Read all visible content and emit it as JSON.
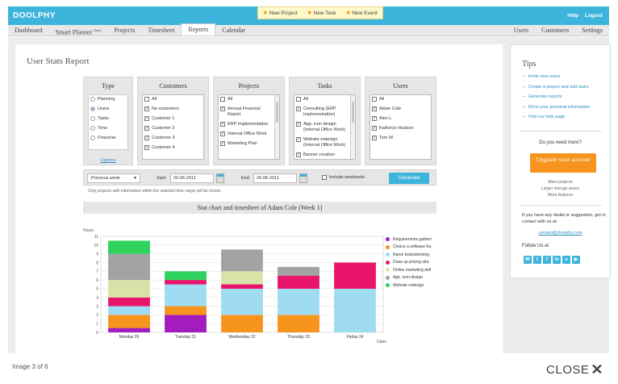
{
  "topbar": {
    "logo": "DOOLPHY",
    "quick_actions": [
      "New Project",
      "New Task",
      "New Event"
    ],
    "links": [
      "Help",
      "Logout"
    ]
  },
  "nav": {
    "left_tabs": [
      "Dashboard",
      "Smart Planner",
      "Projects",
      "Timesheet",
      "Reports",
      "Calendar"
    ],
    "beta_label": "(beta)",
    "active_tab": "Reports",
    "right_tabs": [
      "Users",
      "Customers",
      "Settings"
    ]
  },
  "report": {
    "title": "User Stats Report",
    "filters": {
      "type": {
        "heading": "Type",
        "options": [
          {
            "label": "Planning",
            "selected": false
          },
          {
            "label": "Users",
            "selected": true
          },
          {
            "label": "Tasks",
            "selected": false
          },
          {
            "label": "Time",
            "selected": false
          },
          {
            "label": "Financial",
            "selected": false
          }
        ],
        "options_link": "Options"
      },
      "customers": {
        "heading": "Customers",
        "items": [
          {
            "label": "All",
            "checked": false
          },
          {
            "label": "No customers",
            "checked": true
          },
          {
            "label": "Customer 1",
            "checked": true
          },
          {
            "label": "Customer 2",
            "checked": true
          },
          {
            "label": "Customer 3",
            "checked": true
          },
          {
            "label": "Customer 4",
            "checked": true
          }
        ]
      },
      "projects": {
        "heading": "Projects",
        "items": [
          {
            "label": "All",
            "checked": false
          },
          {
            "label": "Annual Financial Report",
            "checked": true
          },
          {
            "label": "ERP Implementation",
            "checked": true
          },
          {
            "label": "Internal Office Work",
            "checked": true
          },
          {
            "label": "Marketing Plan",
            "checked": true
          }
        ]
      },
      "tasks": {
        "heading": "Tasks",
        "items": [
          {
            "label": "All",
            "checked": false
          },
          {
            "label": "Consulting (ERP Implementation)",
            "checked": true
          },
          {
            "label": "App. icon design (Internal Office Work)",
            "checked": true
          },
          {
            "label": "Website redesign (Internal Office Work)",
            "checked": true
          },
          {
            "label": "Banner creation",
            "checked": true
          }
        ]
      },
      "users": {
        "heading": "Users",
        "items": [
          {
            "label": "All",
            "checked": false
          },
          {
            "label": "Adam Cole",
            "checked": true
          },
          {
            "label": "Alex L.",
            "checked": true
          },
          {
            "label": "Katheryn Hudson",
            "checked": true
          },
          {
            "label": "Tom W.",
            "checked": true
          }
        ]
      }
    },
    "period": {
      "selected": "Previous week",
      "start_label": "Start",
      "start_value": "20-06-2011",
      "end_label": "End",
      "end_value": "26-06-2011",
      "include_weekends_label": "Include weekends",
      "include_weekends": false,
      "generate_label": "Generate"
    },
    "note": "Only projects with information within the selected time range will be shown.",
    "chart_title": "Stat chart and timesheet of Adam Cole (Week 1)"
  },
  "chart_data": {
    "type": "bar",
    "stacked": true,
    "title": "Stat chart and timesheet of Adam Cole (Week 1)",
    "ylabel": "Hours",
    "xlabel": "Dates",
    "ylim": [
      0,
      11
    ],
    "yticks": [
      0,
      1,
      2,
      3,
      4,
      5,
      6,
      7,
      8,
      9,
      10,
      11
    ],
    "categories": [
      "Monday 20",
      "Tuesday 21",
      "Wednesday 22",
      "Thursday 23",
      "Friday 24"
    ],
    "legend_position": "right",
    "series": [
      {
        "name": "Requirements gathering",
        "color": "#a21cc0",
        "values": [
          0.5,
          2.0,
          0.0,
          0.0,
          0.0
        ]
      },
      {
        "name": "Choice a software framework",
        "color": "#f7941d",
        "values": [
          1.5,
          1.0,
          2.0,
          2.0,
          0.0
        ]
      },
      {
        "name": "Name brainstorming",
        "color": "#9fdcf2",
        "values": [
          1.0,
          2.5,
          3.0,
          3.0,
          5.0
        ]
      },
      {
        "name": "Draw up pricing strategy",
        "color": "#e8156b",
        "values": [
          1.0,
          0.5,
          0.5,
          1.5,
          3.0
        ]
      },
      {
        "name": "Online marketing definition",
        "color": "#d9e3a8",
        "values": [
          2.0,
          0.0,
          1.5,
          0.0,
          0.0
        ]
      },
      {
        "name": "App. icon design",
        "color": "#a3a3a3",
        "values": [
          3.0,
          0.0,
          2.5,
          1.0,
          0.0
        ]
      },
      {
        "name": "Website redesign",
        "color": "#2ed35e",
        "values": [
          1.5,
          1.0,
          0.0,
          0.0,
          0.0
        ]
      }
    ]
  },
  "legend": {
    "labels": [
      "Requirements gatheri",
      "Choice a software fra",
      "Name brainstorming",
      "Draw up pricing stra",
      "Online marketing defi",
      "App. icon design",
      "Website redesign"
    ]
  },
  "tips": {
    "heading": "Tips",
    "links": [
      "Invite new users",
      "Create a project and add tasks",
      "Generate reports",
      "Fill in your personal information",
      "Visit our help page"
    ],
    "need_more": "Do you need more?",
    "upgrade_label": "Upgrade your account",
    "features": [
      "More projects",
      "Larger storage space",
      "More features"
    ],
    "doubt_text": "If you have any doubt or suggestion, get in contact with us at:",
    "contact_email": "contact@doolphy.com",
    "follow_label": "Follow Us at",
    "social_icons": [
      "W",
      "t",
      "f",
      "in",
      "●",
      "▶"
    ]
  },
  "gallery": {
    "counter": "Image 3 of 6",
    "close_label": "CLOSE"
  },
  "colors": {
    "brand": "#3cb4dc",
    "upgrade": "#f6941d"
  }
}
